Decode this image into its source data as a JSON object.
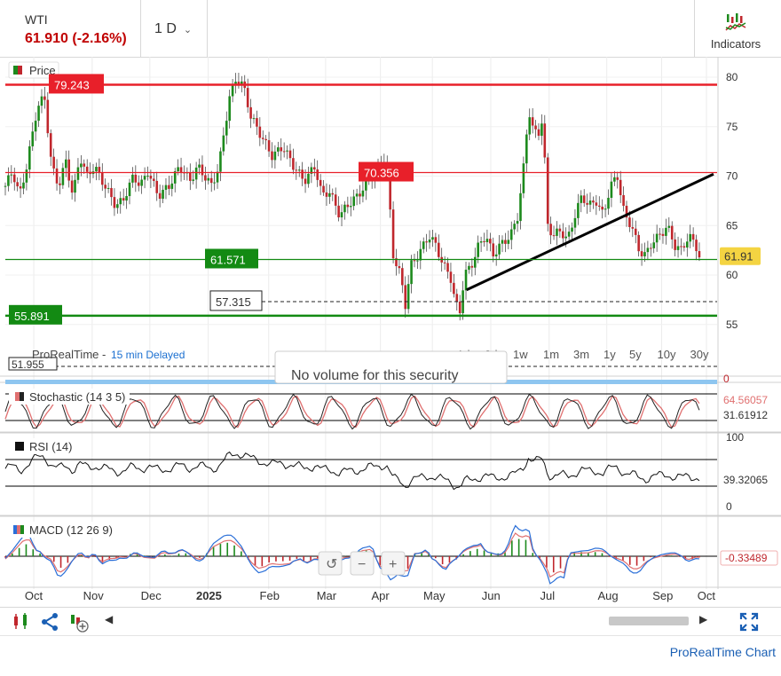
{
  "header": {
    "symbol": "WTI",
    "quote": "61.910 (-2.16%)",
    "interval": "1 D",
    "indicators_label": "Indicators"
  },
  "colors": {
    "up": "#1d8a1d",
    "down": "#c0272d",
    "resistance": "#e8202a",
    "support": "#138a13",
    "price_tag": "#f4d442"
  },
  "chart_data": {
    "type": "line",
    "price_panel": {
      "label": "Price",
      "y_ticks": [
        80,
        75,
        70,
        65,
        60,
        55
      ],
      "last_price": "61.91",
      "series_points": [
        [
          0.0,
          69
        ],
        [
          0.01,
          70.5
        ],
        [
          0.02,
          68
        ],
        [
          0.03,
          71
        ],
        [
          0.045,
          77
        ],
        [
          0.055,
          78
        ],
        [
          0.065,
          71
        ],
        [
          0.075,
          69
        ],
        [
          0.085,
          71.5
        ],
        [
          0.095,
          68
        ],
        [
          0.105,
          72
        ],
        [
          0.115,
          70
        ],
        [
          0.125,
          71
        ],
        [
          0.14,
          69
        ],
        [
          0.155,
          67
        ],
        [
          0.165,
          67.5
        ],
        [
          0.18,
          70
        ],
        [
          0.19,
          69
        ],
        [
          0.2,
          70.5
        ],
        [
          0.215,
          68
        ],
        [
          0.23,
          69
        ],
        [
          0.245,
          71
        ],
        [
          0.26,
          69.5
        ],
        [
          0.27,
          71
        ],
        [
          0.29,
          69
        ],
        [
          0.3,
          71
        ],
        [
          0.315,
          78
        ],
        [
          0.325,
          80
        ],
        [
          0.335,
          79
        ],
        [
          0.345,
          76
        ],
        [
          0.36,
          74
        ],
        [
          0.375,
          72
        ],
        [
          0.39,
          73
        ],
        [
          0.405,
          71
        ],
        [
          0.42,
          69.5
        ],
        [
          0.435,
          71
        ],
        [
          0.445,
          68
        ],
        [
          0.455,
          68.5
        ],
        [
          0.47,
          66
        ],
        [
          0.48,
          67
        ],
        [
          0.495,
          68
        ],
        [
          0.505,
          69
        ],
        [
          0.515,
          70
        ],
        [
          0.525,
          71
        ],
        [
          0.535,
          72
        ],
        [
          0.545,
          62
        ],
        [
          0.555,
          60
        ],
        [
          0.562,
          57
        ],
        [
          0.57,
          61
        ],
        [
          0.58,
          62
        ],
        [
          0.595,
          64
        ],
        [
          0.605,
          63
        ],
        [
          0.615,
          61
        ],
        [
          0.625,
          60
        ],
        [
          0.63,
          58
        ],
        [
          0.638,
          56
        ],
        [
          0.645,
          60
        ],
        [
          0.655,
          61
        ],
        [
          0.665,
          63
        ],
        [
          0.675,
          64
        ],
        [
          0.685,
          62
        ],
        [
          0.695,
          63
        ],
        [
          0.71,
          64
        ],
        [
          0.72,
          66
        ],
        [
          0.73,
          72
        ],
        [
          0.735,
          77
        ],
        [
          0.74,
          75
        ],
        [
          0.748,
          74
        ],
        [
          0.755,
          76
        ],
        [
          0.762,
          65
        ],
        [
          0.77,
          64
        ],
        [
          0.78,
          64.5
        ],
        [
          0.79,
          63.5
        ],
        [
          0.8,
          66
        ],
        [
          0.81,
          68
        ],
        [
          0.82,
          67
        ],
        [
          0.83,
          67.5
        ],
        [
          0.84,
          66
        ],
        [
          0.85,
          69
        ],
        [
          0.86,
          70
        ],
        [
          0.87,
          66
        ],
        [
          0.88,
          65
        ],
        [
          0.89,
          62.5
        ],
        [
          0.9,
          62
        ],
        [
          0.91,
          63.5
        ],
        [
          0.92,
          64
        ],
        [
          0.93,
          65
        ],
        [
          0.94,
          63
        ],
        [
          0.95,
          62.5
        ],
        [
          0.96,
          64
        ],
        [
          0.97,
          63
        ],
        [
          0.975,
          61.9
        ]
      ],
      "levels": [
        {
          "label": "79.243",
          "value": 79.243,
          "style": "resistance"
        },
        {
          "label": "70.356",
          "value": 70.356,
          "style": "resistance"
        },
        {
          "label": "61.571",
          "value": 61.571,
          "style": "support"
        },
        {
          "label": "57.315",
          "value": 57.315,
          "style": "dashed"
        },
        {
          "label": "55.891",
          "value": 55.891,
          "style": "support"
        },
        {
          "label": "51.955",
          "value": 51.955,
          "style": "dashed"
        }
      ],
      "trendline": [
        [
          0.648,
          58.5
        ],
        [
          0.995,
          70.2
        ]
      ],
      "source": "ProRealTime -",
      "delay": "15 min Delayed",
      "no_volume": "No volume for this security",
      "ranges": [
        "1d",
        "2d",
        "1w",
        "1m",
        "3m",
        "1y",
        "5y",
        "10y",
        "30y"
      ]
    },
    "stochastic": {
      "label": "Stochastic (14 3 5)",
      "upper_value": "64.56057",
      "lower_value": "31.61912"
    },
    "rsi": {
      "label": "RSI (14)",
      "top_tick": "100",
      "bottom_tick": "0",
      "value": "39.32065"
    },
    "macd": {
      "label": "MACD (12 26 9)",
      "value": "-0.33489"
    },
    "volume_tick": "0",
    "x_ticks": [
      "Oct",
      "Nov",
      "Dec",
      "2025",
      "Feb",
      "Mar",
      "Apr",
      "May",
      "Jun",
      "Jul",
      "Aug",
      "Sep",
      "Oct"
    ]
  },
  "footer": {
    "brand": "ProRealTime Chart"
  }
}
